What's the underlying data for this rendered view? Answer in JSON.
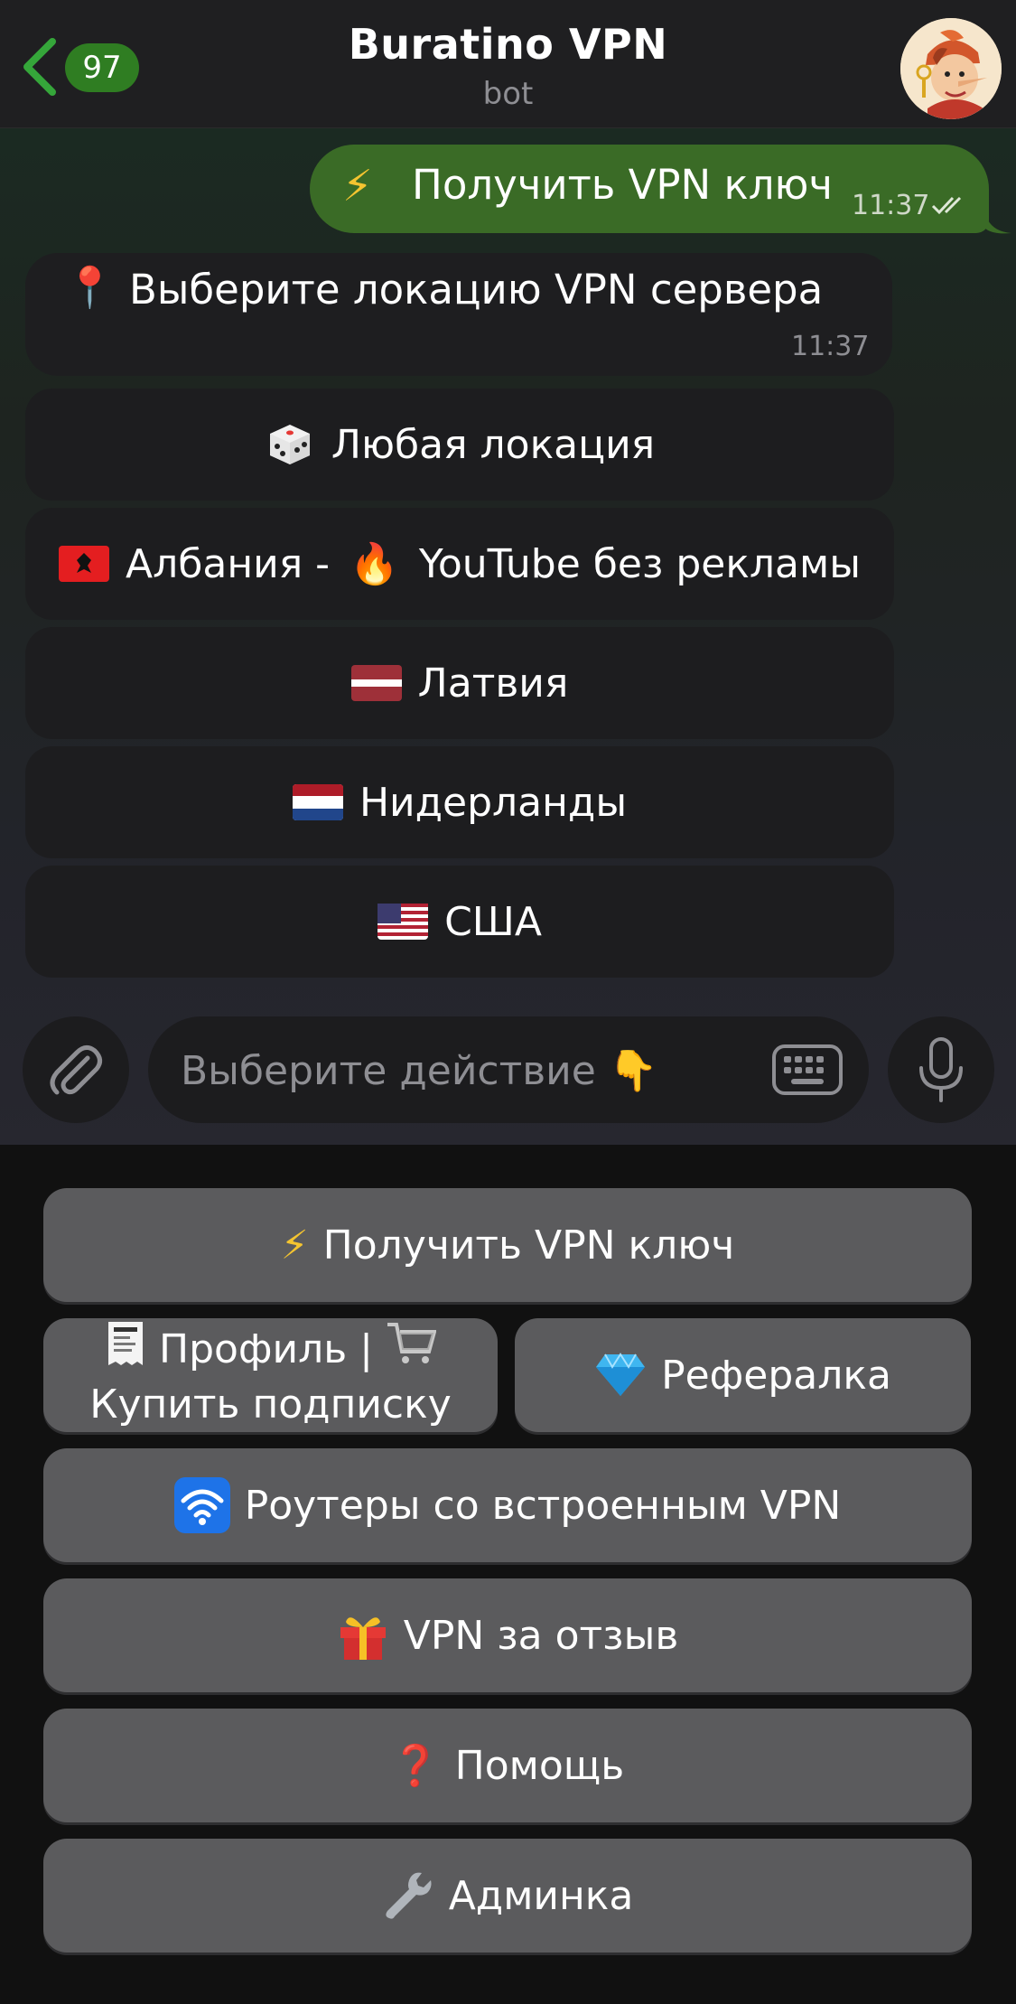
{
  "header": {
    "unread_count": "97",
    "title": "Buratino VPN",
    "subtitle": "bot"
  },
  "messages": {
    "outgoing": {
      "text": "Получить VPN ключ",
      "time": "11:37",
      "icon": "lightning-icon"
    },
    "incoming": {
      "text": "Выберите локацию VPN сервера",
      "time": "11:37",
      "icon": "pin-icon"
    }
  },
  "inline_buttons": [
    {
      "label": "Любая локация",
      "icon": "dice-icon"
    },
    {
      "label": "Албания - ",
      "label2": " YouTube без рекламы",
      "icon": "albania-flag-icon",
      "icon2": "fire-icon"
    },
    {
      "label": "Латвия",
      "icon": "latvia-flag-icon"
    },
    {
      "label": "Нидерланды",
      "icon": "netherlands-flag-icon"
    },
    {
      "label": "США",
      "icon": "usa-flag-icon"
    }
  ],
  "input": {
    "placeholder": "Выберите действие"
  },
  "keyboard": {
    "get_key": "Получить VPN ключ",
    "profile_line1": "Профиль |",
    "profile_line2": "Купить подписку",
    "referral": "Рефералка",
    "routers": "Роутеры со встроенным VPN",
    "review": "VPN за отзыв",
    "help": "Помощь",
    "admin": "Админка"
  },
  "colors": {
    "accent_green": "#3a6b26",
    "badge_green": "#2f7d22",
    "key_bg": "#5b5b5d"
  }
}
